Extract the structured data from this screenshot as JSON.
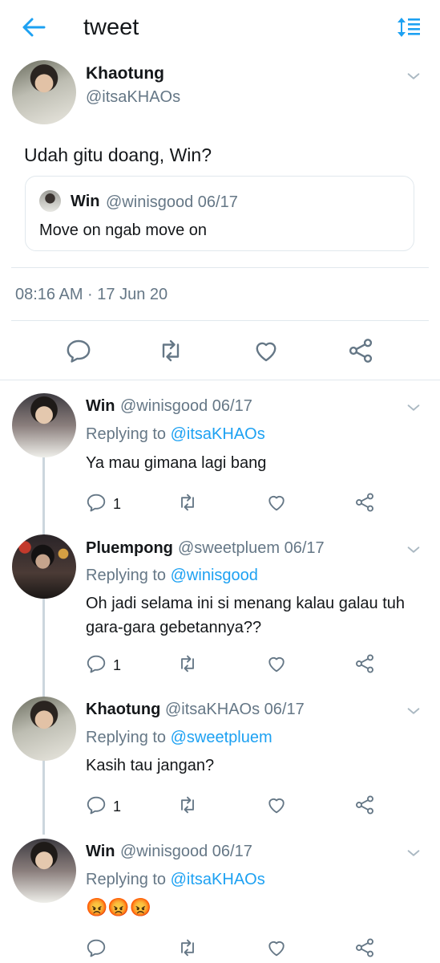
{
  "header": {
    "title": "tweet"
  },
  "main_tweet": {
    "name": "Khaotung",
    "handle": "@itsaKHAOs",
    "text": "Udah gitu doang, Win?",
    "quote": {
      "name": "Win",
      "meta": "@winisgood 06/17",
      "text": "Move on ngab move on"
    },
    "timestamp": "08:16 AM · 17 Jun 20"
  },
  "replies": [
    {
      "name": "Win",
      "meta": "@winisgood 06/17",
      "replying_label": "Replying to",
      "replying_to": "@itsaKHAOs",
      "text": "Ya mau gimana lagi bang",
      "reply_count": "1"
    },
    {
      "name": "Pluempong",
      "meta": "@sweetpluem 06/17",
      "replying_label": "Replying to",
      "replying_to": "@winisgood",
      "text_line1": "Oh jadi selama ini si menang kalau galau tuh",
      "text_line2": "gara-gara gebetannya??",
      "reply_count": "1"
    },
    {
      "name": "Khaotung",
      "meta": "@itsaKHAOs 06/17",
      "replying_label": "Replying to",
      "replying_to": "@sweetpluem",
      "text": "Kasih tau jangan?",
      "reply_count": "1"
    },
    {
      "name": "Win",
      "meta": "@winisgood 06/17",
      "replying_label": "Replying to",
      "replying_to": "@itsaKHAOs",
      "text": "😡😡😡"
    }
  ],
  "colors": {
    "accent": "#1da1f2",
    "muted": "#657786",
    "divider": "#e1e8ed",
    "icon": "#657786"
  },
  "icons": [
    "back-arrow-icon",
    "sort-icon",
    "chevron-down-icon",
    "reply-icon",
    "retweet-icon",
    "like-icon",
    "share-icon"
  ]
}
